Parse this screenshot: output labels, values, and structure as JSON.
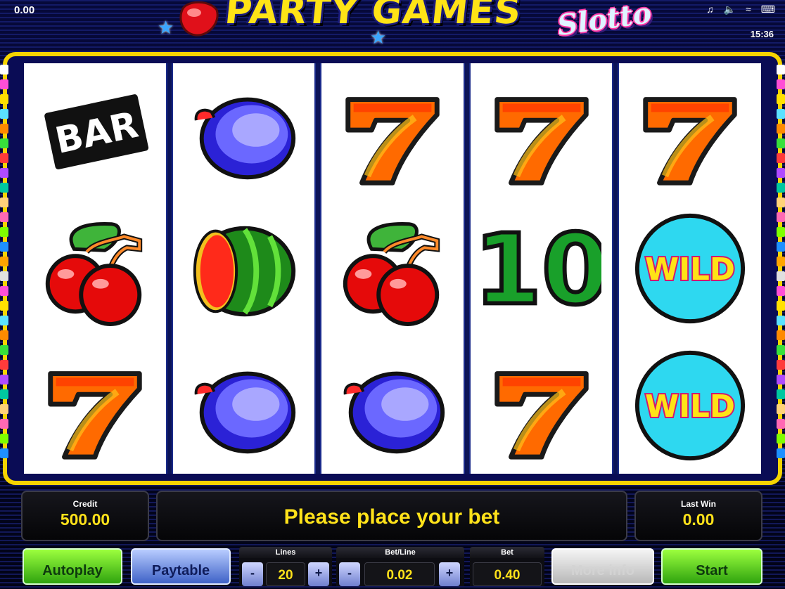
{
  "status_bar": {
    "credit_top": "0.00",
    "clock": "15:36",
    "icons": [
      "music-note-icon",
      "volume-icon",
      "wifi-icon",
      "keyboard-icon"
    ]
  },
  "logo": {
    "title": "PARTY GAMES",
    "subtitle": "Slotto"
  },
  "reels": [
    [
      "bar",
      "cherry",
      "seven"
    ],
    [
      "plum",
      "watermelon",
      "plum"
    ],
    [
      "seven",
      "cherry",
      "plum"
    ],
    [
      "seven",
      "ten",
      "seven"
    ],
    [
      "seven",
      "wild",
      "wild"
    ]
  ],
  "symbol_text": {
    "bar": "BAR",
    "ten": "10",
    "wild": "WILD"
  },
  "panels": {
    "credit_label": "Credit",
    "credit_value": "500.00",
    "message": "Please place your bet",
    "last_win_label": "Last Win",
    "last_win_value": "0.00"
  },
  "controls": {
    "autoplay": "Autoplay",
    "paytable": "Paytable",
    "lines_label": "Lines",
    "lines_value": "20",
    "bet_line_label": "Bet/Line",
    "bet_line_value": "0.02",
    "bet_label": "Bet",
    "bet_value": "0.40",
    "minus": "-",
    "plus": "+",
    "more_info": "More info",
    "start": "Start"
  },
  "colors": {
    "frame": "#f6d400",
    "accent_text": "#ffe21a",
    "background": "#03051f"
  },
  "line_marker_colors": [
    "#ffffff",
    "#ff4fd6",
    "#ffe100",
    "#5ce1ff",
    "#ff8a00",
    "#38e03b",
    "#ff3b3b",
    "#b04bff",
    "#00c8a0",
    "#ffd27a",
    "#ff69b4",
    "#7fff00",
    "#1e90ff",
    "#ffa500",
    "#e0e0e0",
    "#ff4fd6",
    "#ffe100",
    "#5ce1ff",
    "#ff8a00",
    "#38e03b",
    "#ff3b3b",
    "#b04bff",
    "#00c8a0",
    "#ffd27a",
    "#ff69b4",
    "#7fff00",
    "#1e90ff"
  ]
}
